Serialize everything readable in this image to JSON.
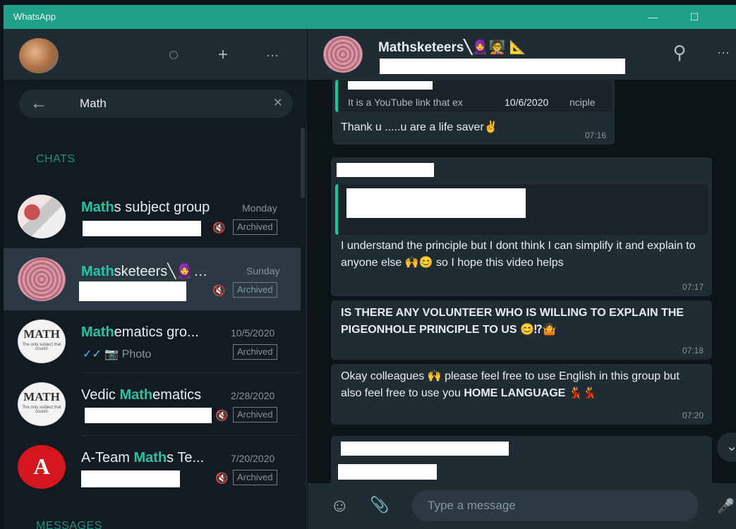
{
  "app": {
    "title": "WhatsApp",
    "minimize": "—",
    "maximize": "☐"
  },
  "left_header": {
    "status_icon": "◌",
    "new_chat_icon": "+",
    "menu_icon": "···"
  },
  "search": {
    "back_icon": "←",
    "value": "Math",
    "clear_icon": "✕"
  },
  "sections": {
    "chats": "CHATS",
    "messages": "MESSAGES"
  },
  "chats": [
    {
      "name_hl": "Math",
      "name_rest": "s subject group",
      "date": "Monday",
      "archived": "Archived",
      "muted_icon": "🔇"
    },
    {
      "name_hl": "Math",
      "name_rest": "sketeers╲🧕…",
      "date": "Sunday",
      "archived": "Archived",
      "muted_icon": "🔇"
    },
    {
      "name_hl": "Math",
      "name_pre": "",
      "name_rest": "ematics gro...",
      "date": "10/5/2020",
      "archived": "Archived",
      "ticks": "✓✓",
      "camera_icon": "📷",
      "preview": "Photo"
    },
    {
      "name_pre": "Vedic ",
      "name_hl": "Math",
      "name_rest": "ematics",
      "date": "2/28/2020",
      "archived": "Archived",
      "muted_icon": "🔇"
    },
    {
      "name_pre": "A-Team ",
      "name_hl": "Math",
      "name_rest": "s Te...",
      "date": "7/20/2020",
      "archived": "Archived",
      "muted_icon": "🔇"
    }
  ],
  "avatars": {
    "math_text": "MATH",
    "math_sub": "The only subject that counts",
    "a_team_text": "A"
  },
  "conversation": {
    "group_name": "Mathsketeers╲🧕🧑‍🏫  📐",
    "search_icon": "⚲",
    "menu_icon": "···",
    "quoted_text": "It is a YouTube link that ex",
    "quoted_date": "10/6/2020",
    "quoted_tail": "nciple",
    "messages": [
      {
        "text": "Thank u .....u are a life saver✌",
        "time": "07:16"
      },
      {
        "text": "I understand the principle but I dont think I can simplify it and explain to anyone else 🙌😊 so I hope this video helps",
        "time": "07:17"
      },
      {
        "text": "IS THERE ANY VOLUNTEER WHO IS WILLING TO EXPLAIN THE PIGEONHOLE PRINCIPLE TO US 😊⁉🤷",
        "time": "07:18"
      },
      {
        "text_a": "Okay colleagues 🙌 please feel free to use English in this group  but also feel free to use you ",
        "text_b": "HOME LANGUAGE",
        "text_c": " 💃💃",
        "time": "07:20"
      }
    ],
    "scroll_down_icon": "⌄"
  },
  "compose": {
    "emoji_icon": "☺",
    "attach_icon": "📎",
    "placeholder": "Type a message",
    "mic_icon": "🎤"
  }
}
